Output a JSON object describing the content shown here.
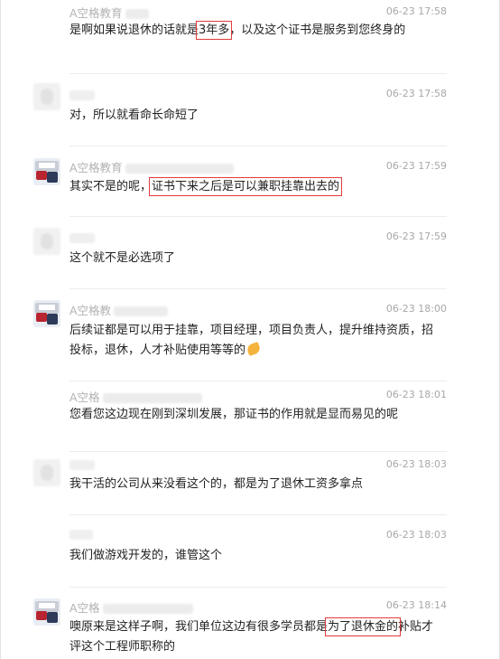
{
  "messages": [
    {
      "sender": "A空格教育",
      "time": "06-23 17:58",
      "text_before": "是啊如果说退休的话就是",
      "highlight": "3年多",
      "text_after": "，以及这个证书是服务到您终身的"
    },
    {
      "sender": "",
      "time": "06-23 17:58",
      "text": "对，所以就看命长命短了"
    },
    {
      "sender": "A空格教育",
      "time": "06-23 17:59",
      "text_before": "其实不是的呢，",
      "highlight": "证书下来之后是可以兼职挂靠出去的",
      "text_after": ""
    },
    {
      "sender": "",
      "time": "06-23 17:59",
      "text": "这个就不是必选项了"
    },
    {
      "sender": "A空格教",
      "time": "06-23 18:00",
      "text": "后续证都是可以用于挂靠，项目经理，项目负责人，提升维持资质，招投标，退休，人才补贴使用等等的",
      "emoji": "muscle-emoji"
    },
    {
      "sender": "A空格",
      "time": "06-23 18:01",
      "text": "您看您这边现在刚到深圳发展，那证书的作用就是显而易见的呢"
    },
    {
      "sender": "",
      "time": "06-23 18:03",
      "text": "我干活的公司从来没看这个的，都是为了退休工资多拿点"
    },
    {
      "sender": "",
      "time": "06-23 18:03",
      "text": "我们做游戏开发的，谁管这个"
    },
    {
      "sender": "A空格",
      "time": "06-23 18:14",
      "text_before": "噢原来是这样子啊，我们单位这边有很多学员都是",
      "highlight": "为了退休金的",
      "text_after": "补贴才评这个工程师职称的"
    }
  ]
}
